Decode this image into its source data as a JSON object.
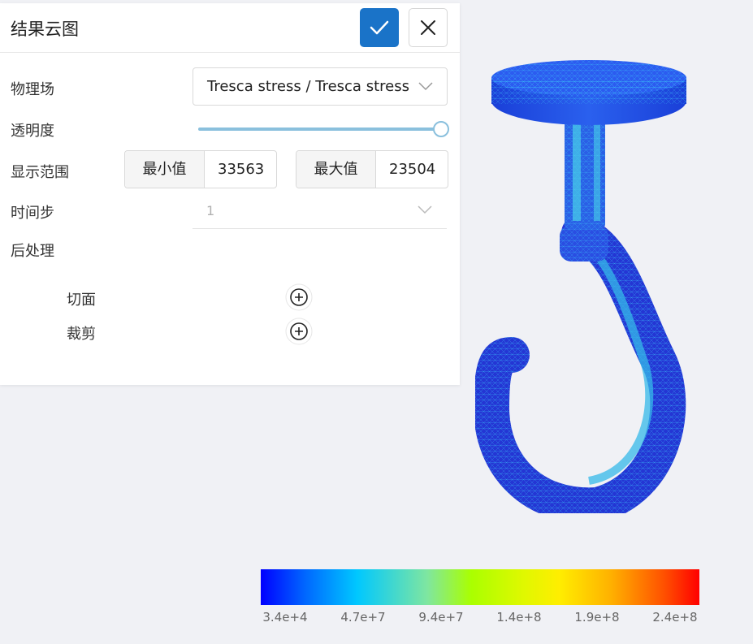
{
  "panel": {
    "title": "结果云图",
    "confirm_icon": "check-icon",
    "close_icon": "close-icon",
    "confirm_color": "#1a73c8"
  },
  "field": {
    "label": "物理场",
    "value": "Tresca stress / Tresca stress"
  },
  "opacity": {
    "label": "透明度",
    "value": 1.0
  },
  "range": {
    "label": "显示范围",
    "min_label": "最小值",
    "min_value": "33563",
    "max_label": "最大值",
    "max_value": "23504"
  },
  "timestep": {
    "label": "时间步",
    "value": "1"
  },
  "postprocess": {
    "label": "后处理",
    "items": [
      {
        "label": "切面",
        "icon": "plus-circle-icon"
      },
      {
        "label": "裁剪",
        "icon": "plus-circle-icon"
      }
    ]
  },
  "colorbar": {
    "ticks": [
      "3.4e+4",
      "4.7e+7",
      "9.4e+7",
      "1.4e+8",
      "1.9e+8",
      "2.4e+8"
    ]
  }
}
